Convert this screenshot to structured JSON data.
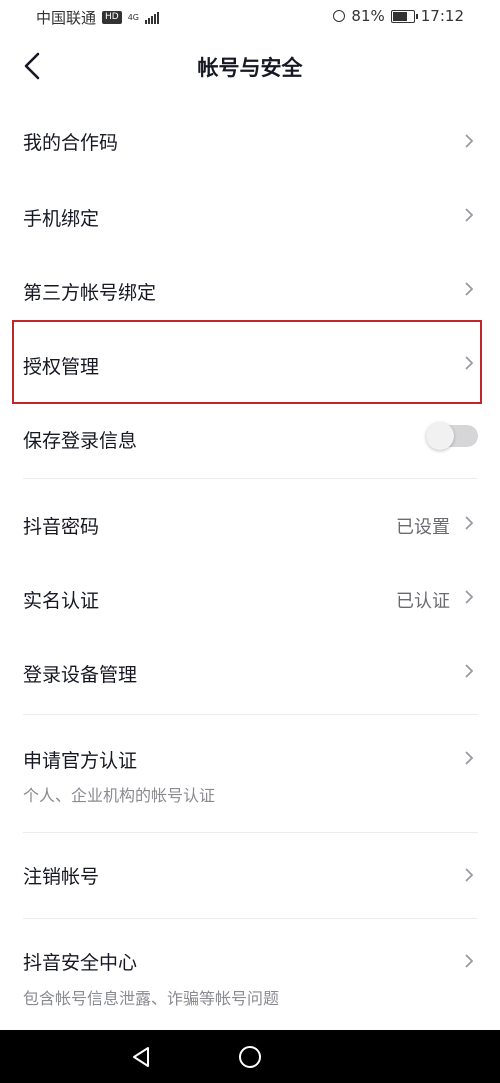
{
  "status_bar": {
    "carrier": "中国联通",
    "hd_badge": "HD",
    "network": "4G",
    "battery": "81%",
    "battery_level": 0.81,
    "time": "17:12"
  },
  "header": {
    "title": "帐号与安全",
    "back_icon": "chevron-left-icon"
  },
  "rows": {
    "partner_code": {
      "label": "我的合作码"
    },
    "phone_binding": {
      "label": "手机绑定"
    },
    "third_party_binding": {
      "label": "第三方帐号绑定"
    },
    "authorization": {
      "label": "授权管理"
    },
    "save_login": {
      "label": "保存登录信息",
      "toggle_on": false
    },
    "douyin_password": {
      "label": "抖音密码",
      "value": "已设置"
    },
    "real_name": {
      "label": "实名认证",
      "value": "已认证"
    },
    "device_management": {
      "label": "登录设备管理"
    },
    "official_verification": {
      "label": "申请官方认证",
      "subtitle": "个人、企业机构的帐号认证"
    },
    "deactivate": {
      "label": "注销帐号"
    },
    "security_center": {
      "label": "抖音安全中心",
      "subtitle": "包含帐号信息泄露、诈骗等帐号问题"
    }
  },
  "highlight_color": "#c0272d",
  "system_nav": {
    "back": "triangle-back-icon",
    "home": "circle-home-icon"
  }
}
